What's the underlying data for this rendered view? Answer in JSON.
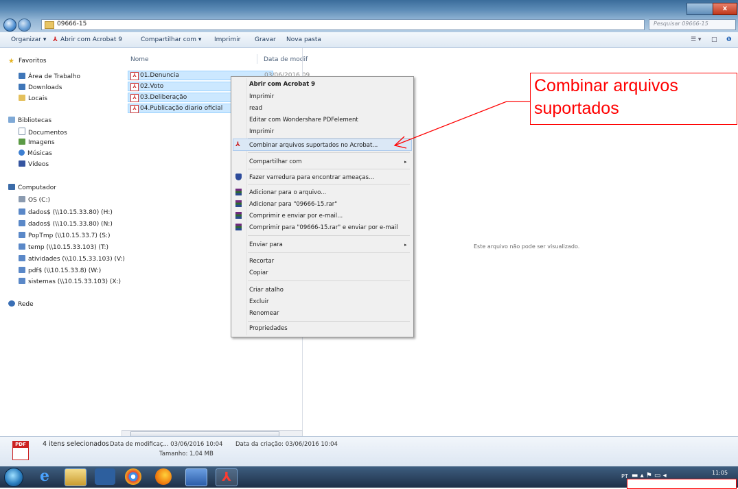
{
  "window": {
    "address_path": "09666-15",
    "search_placeholder": "Pesquisar 09666-15",
    "close_label": "x"
  },
  "toolbar": {
    "organize": "Organizar ▾",
    "open_acrobat": "Abrir com Acrobat 9",
    "share": "Compartilhar com ▾",
    "print": "Imprimir",
    "burn": "Gravar",
    "new_folder": "Nova pasta"
  },
  "sidebar": {
    "favorites": "Favoritos",
    "desktop": "Área de Trabalho",
    "downloads": "Downloads",
    "places": "Locais",
    "libraries": "Bibliotecas",
    "documents": "Documentos",
    "images": "Imagens",
    "music": "Músicas",
    "videos": "Vídeos",
    "computer": "Computador",
    "drives": [
      "OS (C:)",
      "dados$ (\\\\10.15.33.80) (H:)",
      "dados$ (\\\\10.15.33.80) (N:)",
      "PopTmp (\\\\10.15.33.7) (S:)",
      "temp (\\\\10.15.33.103) (T:)",
      "atividades (\\\\10.15.33.103) (V:)",
      "pdf$ (\\\\10.15.33.8) (W:)",
      "sistemas (\\\\10.15.33.103) (X:)"
    ],
    "network": "Rede"
  },
  "filelist": {
    "col_name": "Nome",
    "col_date": "Data de modif",
    "files": [
      {
        "name": "01.Denuncia",
        "date": "03/06/2016 09"
      },
      {
        "name": "02.Voto",
        "date": ""
      },
      {
        "name": "03.Deliberação",
        "date": ""
      },
      {
        "name": "04.Publicação diario oficial",
        "date": ""
      }
    ]
  },
  "preview": {
    "message": "Este arquivo não pode ser visualizado."
  },
  "context_menu": {
    "open_acrobat": "Abrir com Acrobat 9",
    "print1": "Imprimir",
    "read": "read",
    "edit_wondershare": "Editar com Wondershare PDFelement",
    "print2": "Imprimir",
    "combine": "Combinar arquivos suportados no Acrobat...",
    "share": "Compartilhar com",
    "scan": "Fazer varredura para encontrar ameaças...",
    "add_archive": "Adicionar para o arquivo...",
    "add_rar": "Adicionar para \"09666-15.rar\"",
    "compress_email": "Comprimir e enviar por e-mail...",
    "compress_rar_email": "Comprimir para \"09666-15.rar\" e enviar por e-mail",
    "send_to": "Enviar para",
    "cut": "Recortar",
    "copy": "Copiar",
    "shortcut": "Criar atalho",
    "delete": "Excluir",
    "rename": "Renomear",
    "properties": "Propriedades"
  },
  "status": {
    "selected": "4 itens selecionados",
    "modified": "Data de modificaç... 03/06/2016 10:04",
    "created": "Data da criação: 03/06/2016 10:04",
    "size": "Tamanho: 1,04 MB",
    "pdf_badge": "PDF"
  },
  "taskbar": {
    "lang": "PT",
    "time": "11:05"
  },
  "annotation": {
    "text": "Combinar arquivos suportados",
    "color": "#ff0000"
  }
}
